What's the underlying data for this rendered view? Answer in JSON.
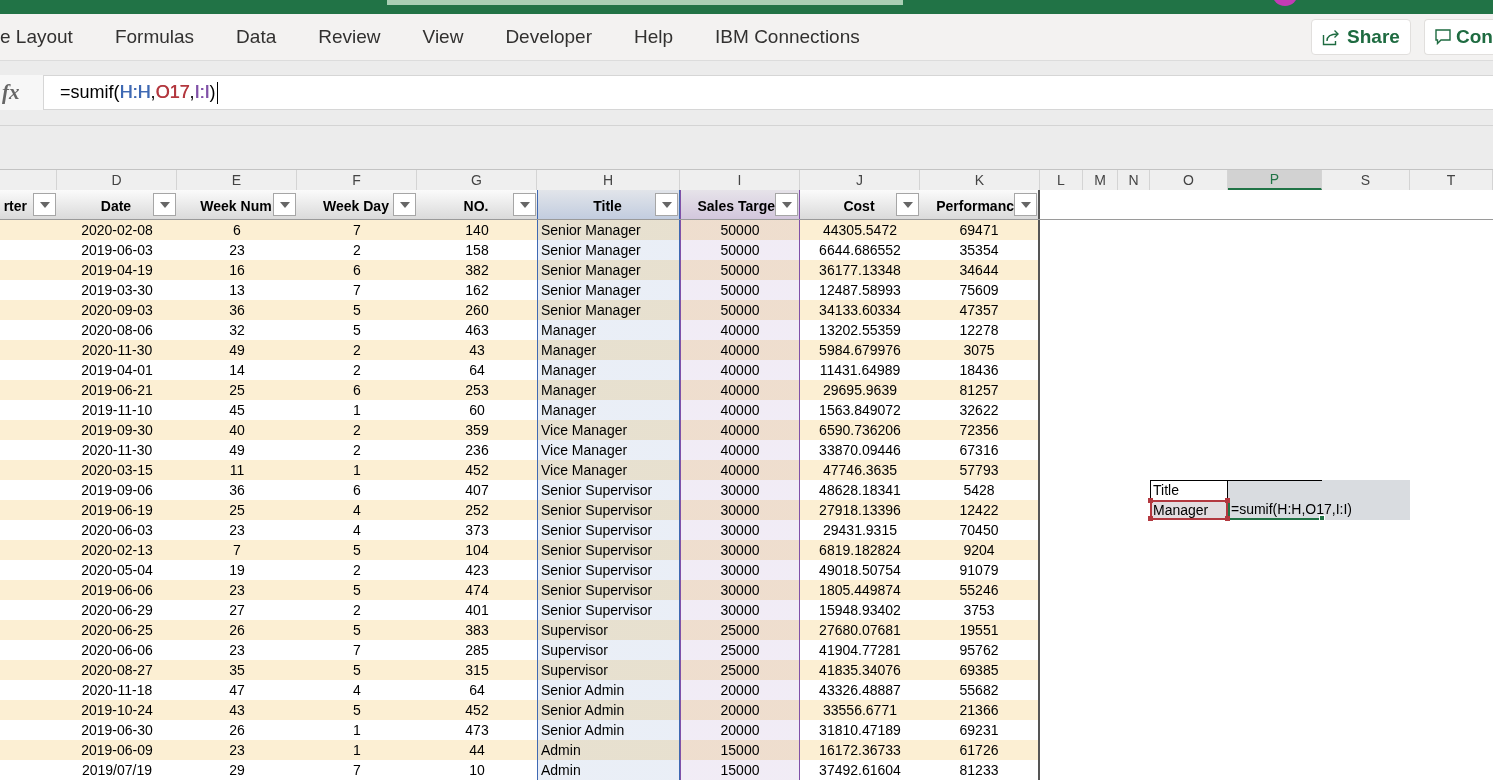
{
  "ribbon": {
    "tabs": [
      {
        "label": "e Layout",
        "selected": false
      },
      {
        "label": "Formulas",
        "selected": false
      },
      {
        "label": "Data",
        "selected": false
      },
      {
        "label": "Review",
        "selected": false
      },
      {
        "label": "View",
        "selected": false
      },
      {
        "label": "Developer",
        "selected": false
      },
      {
        "label": "Help",
        "selected": false
      },
      {
        "label": "IBM Connections",
        "selected": false
      }
    ],
    "share_button": {
      "label": "Share"
    },
    "comments_button": {
      "label": "Con"
    }
  },
  "formula_bar": {
    "function_button": {
      "label": "fx"
    },
    "tokens": [
      {
        "text": "=sumif(",
        "kind": "plain"
      },
      {
        "text": "H:H",
        "kind": "reference",
        "color": "#3f69b3"
      },
      {
        "text": ",",
        "kind": "plain"
      },
      {
        "text": "O17",
        "kind": "reference",
        "color": "#b3383f"
      },
      {
        "text": ",",
        "kind": "plain"
      },
      {
        "text": "I:I",
        "kind": "reference",
        "color": "#8051a8"
      },
      {
        "text": ")",
        "kind": "plain"
      }
    ]
  },
  "column_letters": [
    {
      "label": "D",
      "selected": false
    },
    {
      "label": "E",
      "selected": false
    },
    {
      "label": "F",
      "selected": false
    },
    {
      "label": "G",
      "selected": false
    },
    {
      "label": "H",
      "selected": false
    },
    {
      "label": "I",
      "selected": false
    },
    {
      "label": "J",
      "selected": false
    },
    {
      "label": "K",
      "selected": false
    },
    {
      "label": "L",
      "selected": false
    },
    {
      "label": "M",
      "selected": false
    },
    {
      "label": "N",
      "selected": false
    },
    {
      "label": "O",
      "selected": false
    },
    {
      "label": "P",
      "selected": true
    },
    {
      "label": "S",
      "selected": false
    },
    {
      "label": "T",
      "selected": false
    }
  ],
  "table": {
    "cut_heading": "rter",
    "columns": [
      {
        "heading": "Date",
        "kind": "date"
      },
      {
        "heading": "Week Num",
        "kind": "number"
      },
      {
        "heading": "Week Day",
        "kind": "number"
      },
      {
        "heading": "NO.",
        "kind": "number"
      },
      {
        "heading": "Title",
        "kind": "text",
        "color": "#3f69b3"
      },
      {
        "heading": "Sales Targe",
        "kind": "number",
        "color": "#8051a8"
      },
      {
        "heading": "Cost",
        "kind": "number"
      },
      {
        "heading": "Performanc",
        "kind": "number"
      }
    ],
    "rows": [
      [
        "2020-02-08",
        "6",
        "7",
        "140",
        "Senior Manager",
        "50000",
        "44305.5472",
        "69471"
      ],
      [
        "2019-06-03",
        "23",
        "2",
        "158",
        "Senior Manager",
        "50000",
        "6644.686552",
        "35354"
      ],
      [
        "2019-04-19",
        "16",
        "6",
        "382",
        "Senior Manager",
        "50000",
        "36177.13348",
        "34644"
      ],
      [
        "2019-03-30",
        "13",
        "7",
        "162",
        "Senior Manager",
        "50000",
        "12487.58993",
        "75609"
      ],
      [
        "2020-09-03",
        "36",
        "5",
        "260",
        "Senior Manager",
        "50000",
        "34133.60334",
        "47357"
      ],
      [
        "2020-08-06",
        "32",
        "5",
        "463",
        "Manager",
        "40000",
        "13202.55359",
        "12278"
      ],
      [
        "2020-11-30",
        "49",
        "2",
        "43",
        "Manager",
        "40000",
        "5984.679976",
        "3075"
      ],
      [
        "2019-04-01",
        "14",
        "2",
        "64",
        "Manager",
        "40000",
        "11431.64989",
        "18436"
      ],
      [
        "2019-06-21",
        "25",
        "6",
        "253",
        "Manager",
        "40000",
        "29695.9639",
        "81257"
      ],
      [
        "2019-11-10",
        "45",
        "1",
        "60",
        "Manager",
        "40000",
        "1563.849072",
        "32622"
      ],
      [
        "2019-09-30",
        "40",
        "2",
        "359",
        "Vice Manager",
        "40000",
        "6590.736206",
        "72356"
      ],
      [
        "2020-11-30",
        "49",
        "2",
        "236",
        "Vice Manager",
        "40000",
        "33870.09446",
        "67316"
      ],
      [
        "2020-03-15",
        "11",
        "1",
        "452",
        "Vice Manager",
        "40000",
        "47746.3635",
        "57793"
      ],
      [
        "2019-09-06",
        "36",
        "6",
        "407",
        "Senior Supervisor",
        "30000",
        "48628.18341",
        "5428"
      ],
      [
        "2019-06-19",
        "25",
        "4",
        "252",
        "Senior Supervisor",
        "30000",
        "27918.13396",
        "12422"
      ],
      [
        "2020-06-03",
        "23",
        "4",
        "373",
        "Senior Supervisor",
        "30000",
        "29431.9315",
        "70450"
      ],
      [
        "2020-02-13",
        "7",
        "5",
        "104",
        "Senior Supervisor",
        "30000",
        "6819.182824",
        "9204"
      ],
      [
        "2020-05-04",
        "19",
        "2",
        "423",
        "Senior Supervisor",
        "30000",
        "49018.50754",
        "91079"
      ],
      [
        "2019-06-06",
        "23",
        "5",
        "474",
        "Senior Supervisor",
        "30000",
        "1805.449874",
        "55246"
      ],
      [
        "2020-06-29",
        "27",
        "2",
        "401",
        "Senior Supervisor",
        "30000",
        "15948.93402",
        "3753"
      ],
      [
        "2020-06-25",
        "26",
        "5",
        "383",
        "Supervisor",
        "25000",
        "27680.07681",
        "19551"
      ],
      [
        "2020-06-06",
        "23",
        "7",
        "285",
        "Supervisor",
        "25000",
        "41904.77281",
        "95762"
      ],
      [
        "2020-08-27",
        "35",
        "5",
        "315",
        "Supervisor",
        "25000",
        "41835.34076",
        "69385"
      ],
      [
        "2020-11-18",
        "47",
        "4",
        "64",
        "Senior Admin",
        "20000",
        "43326.48887",
        "55682"
      ],
      [
        "2019-10-24",
        "43",
        "5",
        "452",
        "Senior Admin",
        "20000",
        "33556.6771",
        "21366"
      ],
      [
        "2019-06-30",
        "26",
        "1",
        "473",
        "Senior Admin",
        "20000",
        "31810.47189",
        "69231"
      ],
      [
        "2019-06-09",
        "23",
        "1",
        "44",
        "Admin",
        "15000",
        "16172.36733",
        "61726"
      ],
      [
        "2019/07/19",
        "29",
        "7",
        "10",
        "Admin",
        "15000",
        "37492.61604",
        "81233"
      ]
    ]
  },
  "side_cells": {
    "label_cell": {
      "text": "Title"
    },
    "reference_cell": {
      "text": "Manager",
      "color": "#b3383f"
    },
    "editing_cell": {
      "value": "=sumif(H:H,O17,I:I)"
    }
  }
}
